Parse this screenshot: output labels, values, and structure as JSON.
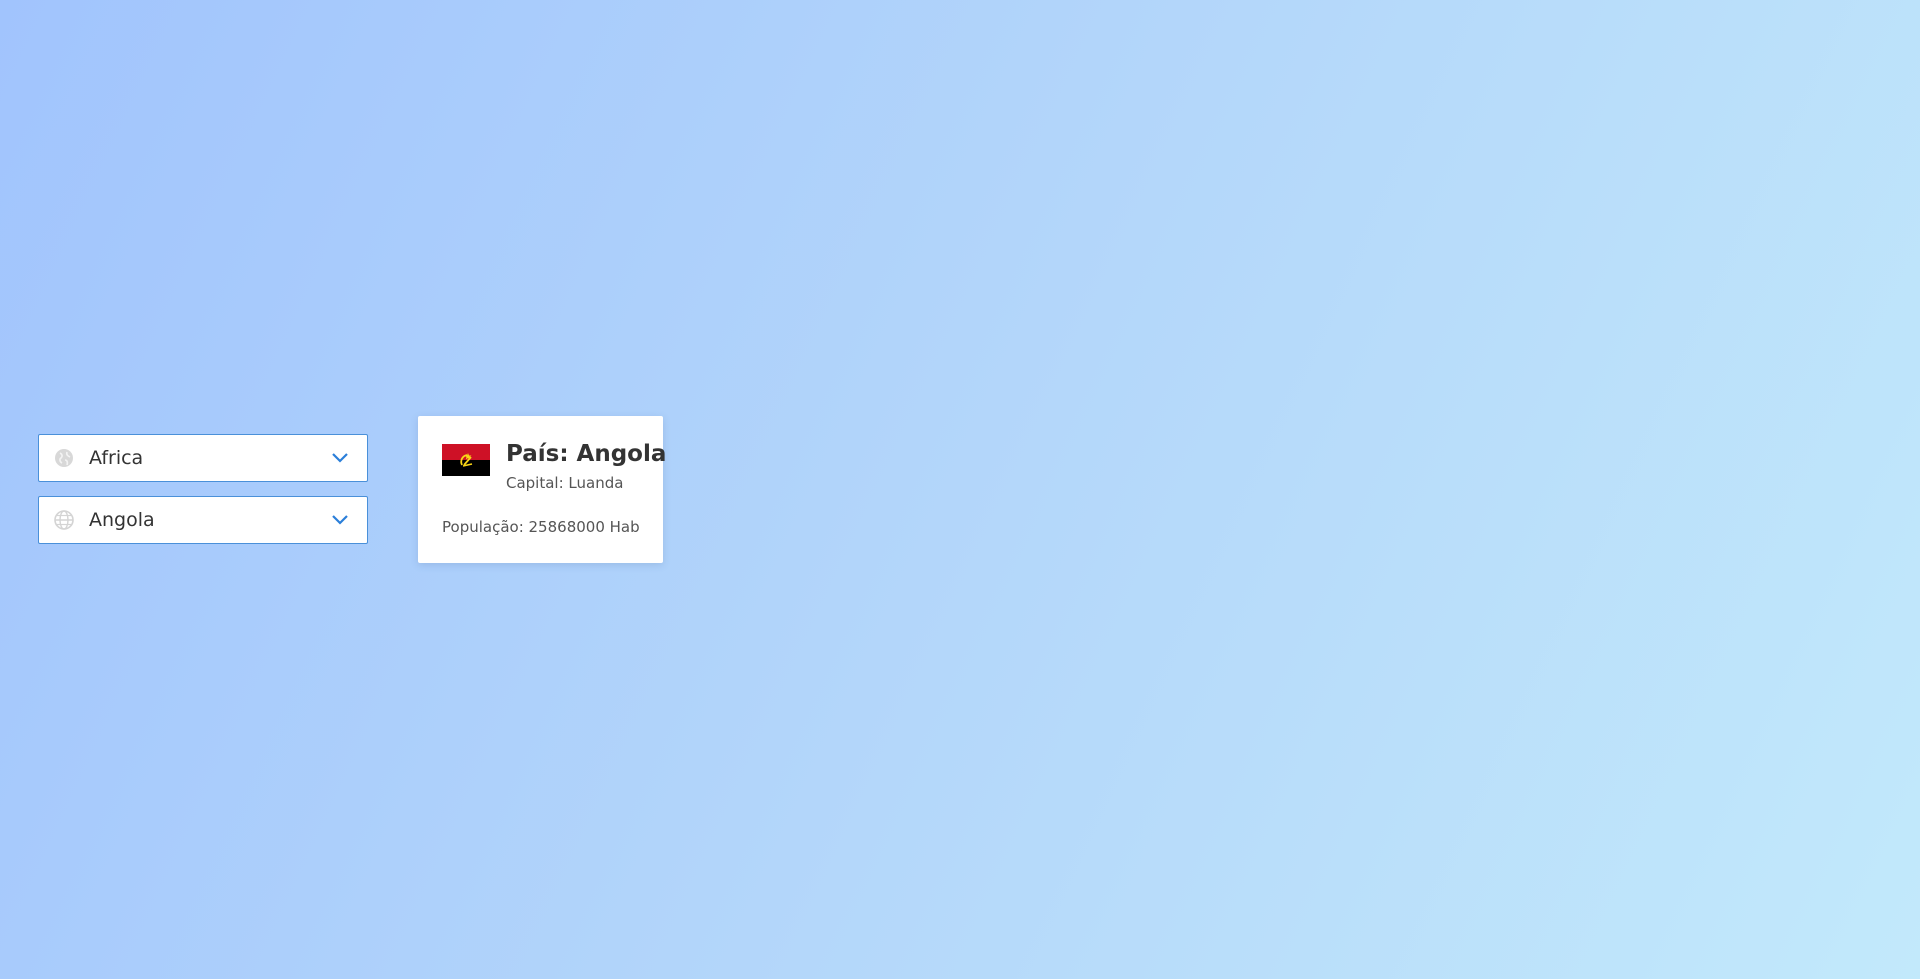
{
  "selects": {
    "continent": {
      "value": "Africa",
      "icon": "globe-icon"
    },
    "country": {
      "value": "Angola",
      "icon": "globe-grid-icon"
    },
    "chevron_color": "#2b7fd9"
  },
  "card": {
    "flag_icon": "angola-flag-icon",
    "title": "País: Angola",
    "capital": "Capital: Luanda",
    "population": "População: 25868000 Hab"
  },
  "colors": {
    "flag_red": "#ce1126",
    "flag_black": "#000000",
    "flag_emblem": "#f9d616"
  }
}
